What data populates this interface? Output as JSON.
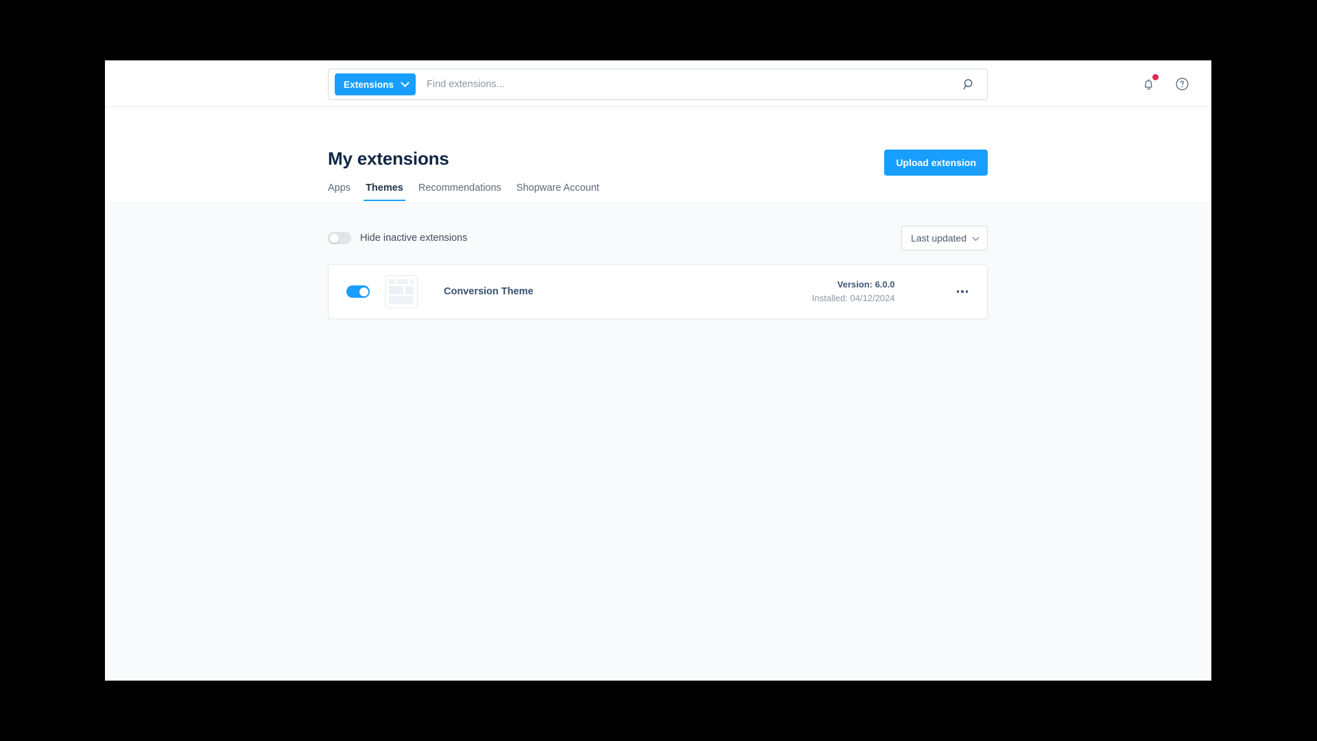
{
  "search": {
    "scope_label": "Extensions",
    "placeholder": "Find extensions...",
    "value": "",
    "search_icon": "search-icon",
    "chevron_icon": "chevron-down-icon"
  },
  "header": {
    "notifications_icon": "bell-icon",
    "has_notification": true,
    "help_icon": "question-circle-icon",
    "title": "My extensions",
    "upload_label": "Upload extension"
  },
  "tabs": [
    {
      "label": "Apps",
      "active": false
    },
    {
      "label": "Themes",
      "active": true
    },
    {
      "label": "Recommendations",
      "active": false
    },
    {
      "label": "Shopware Account",
      "active": false
    }
  ],
  "filters": {
    "hide_inactive_label": "Hide inactive extensions",
    "hide_inactive_on": false,
    "sort_label": "Last updated",
    "sort_chevron_icon": "chevron-down-icon"
  },
  "extensions": [
    {
      "name": "Conversion Theme",
      "enabled": true,
      "thumb_icon": "theme-placeholder-icon",
      "version": "Version: 6.0.0",
      "installed": "Installed: 04/12/2024",
      "menu_icon": "ellipsis-horizontal-icon"
    }
  ],
  "colors": {
    "accent": "#189eff",
    "notification": "#de294c",
    "title": "#0f2744",
    "page_bg": "#f9fafb",
    "panel_bg": "#ffffff"
  }
}
